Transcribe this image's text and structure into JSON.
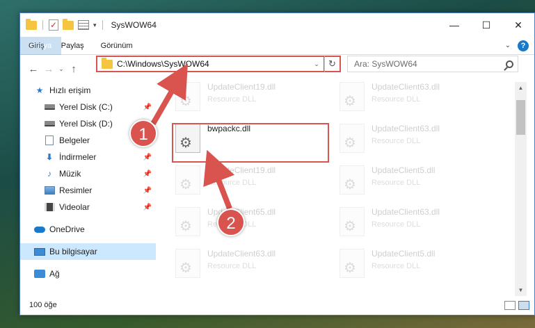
{
  "window": {
    "title": "SysWOW64",
    "controls": {
      "minimize": "—",
      "maximize": "☐",
      "close": "✕"
    }
  },
  "ribbon": {
    "tabs": [
      "Dosya",
      "Giriş",
      "Paylaş",
      "Görünüm"
    ],
    "help": "?"
  },
  "address": {
    "path": "C:\\Windows\\SysWOW64",
    "search_placeholder": "Ara: SysWOW64"
  },
  "nav": {
    "quick_access": "Hızlı erişim",
    "items": [
      {
        "label": "Yerel Disk (C:)",
        "icon": "drive-icon",
        "pinned": true
      },
      {
        "label": "Yerel Disk (D:)",
        "icon": "drive-icon",
        "pinned": false
      },
      {
        "label": "Belgeler",
        "icon": "documents-icon",
        "pinned": true
      },
      {
        "label": "İndirmeler",
        "icon": "download-icon",
        "pinned": true
      },
      {
        "label": "Müzik",
        "icon": "music-icon",
        "pinned": true
      },
      {
        "label": "Resimler",
        "icon": "pictures-icon",
        "pinned": true
      },
      {
        "label": "Videolar",
        "icon": "videos-icon",
        "pinned": true
      }
    ],
    "onedrive": "OneDrive",
    "this_pc": "Bu bilgisayar",
    "network": "Ağ"
  },
  "files": [
    {
      "name": "UpdateClient19.dll",
      "type": "Resource DLL"
    },
    {
      "name": "UpdateClient63.dll",
      "type": "Resource DLL"
    },
    {
      "name": "bwpackc.dll",
      "type": ""
    },
    {
      "name": "UpdateClient63.dll",
      "type": "Resource DLL"
    },
    {
      "name": "UpdateClient19.dll",
      "type": "Resource DLL"
    },
    {
      "name": "UpdateClient5.dll",
      "type": "Resource DLL"
    },
    {
      "name": "UpdateClient65.dll",
      "type": "Resource DLL"
    },
    {
      "name": "UpdateClient63.dll",
      "type": "Resource DLL"
    },
    {
      "name": "UpdateClient63.dll",
      "type": "Resource DLL"
    },
    {
      "name": "UpdateClient5.dll",
      "type": "Resource DLL"
    }
  ],
  "status": {
    "count": "100 öğe"
  },
  "annotations": {
    "step1": "1",
    "step2": "2",
    "color": "#d9534f"
  }
}
